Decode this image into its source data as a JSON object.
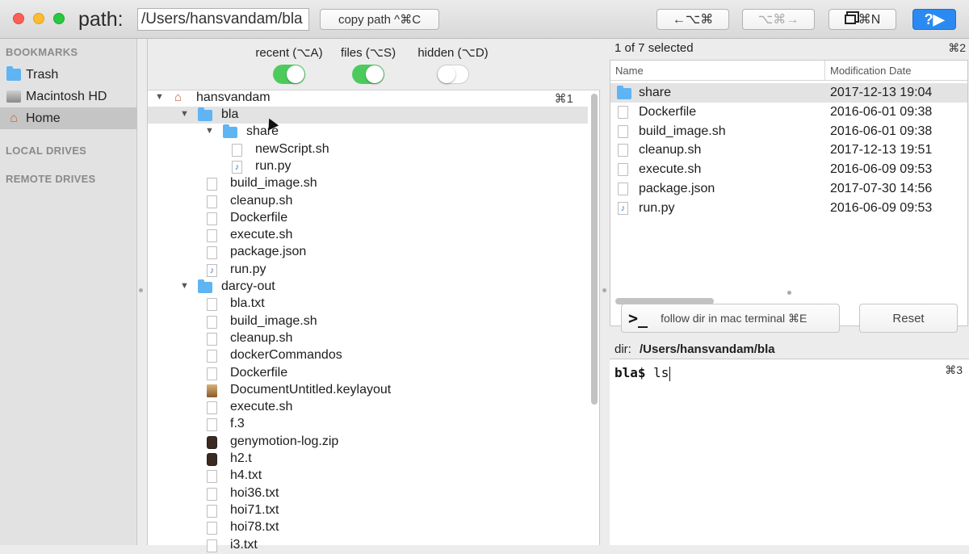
{
  "toolbar": {
    "path_label": "path:",
    "path_value": "/Users/hansvandam/bla",
    "copy_label": "copy path ^⌘C",
    "back_label": "←⌥⌘",
    "forward_label": "⌥⌘→",
    "new_window_label": "⌘N",
    "help_label": "?▶"
  },
  "sidebar": {
    "bookmarks_title": "BOOKMARKS",
    "items": [
      {
        "label": "Trash",
        "icon": "folder-icon"
      },
      {
        "label": "Macintosh HD",
        "icon": "disk-icon"
      },
      {
        "label": "Home",
        "icon": "home-icon",
        "selected": true
      }
    ],
    "local_drives_title": "LOCAL DRIVES",
    "remote_drives_title": "REMOTE DRIVES"
  },
  "toggles": [
    {
      "label": "recent (⌥A)",
      "on": true
    },
    {
      "label": "files  (⌥S)",
      "on": true
    },
    {
      "label": "hidden  (⌥D)",
      "on": false
    }
  ],
  "tree": {
    "root_label": "hansvandam",
    "root_shortcut": "⌘1",
    "rows": [
      {
        "label": "bla",
        "type": "folder",
        "level": 1,
        "disclosure": "▼",
        "selected": true
      },
      {
        "label": "share",
        "type": "folder",
        "level": 2,
        "disclosure": "▼"
      },
      {
        "label": "newScript.sh",
        "type": "doc",
        "level": 3
      },
      {
        "label": "run.py",
        "type": "py",
        "level": 3
      },
      {
        "label": "build_image.sh",
        "type": "doc",
        "level": 2
      },
      {
        "label": "cleanup.sh",
        "type": "doc",
        "level": 2
      },
      {
        "label": "Dockerfile",
        "type": "doc",
        "level": 2
      },
      {
        "label": "execute.sh",
        "type": "doc",
        "level": 2
      },
      {
        "label": "package.json",
        "type": "doc",
        "level": 2
      },
      {
        "label": "run.py",
        "type": "py",
        "level": 2
      },
      {
        "label": "darcy-out",
        "type": "folder",
        "level": 1,
        "disclosure": "▼"
      },
      {
        "label": "bla.txt",
        "type": "doc",
        "level": 2
      },
      {
        "label": "build_image.sh",
        "type": "doc",
        "level": 2
      },
      {
        "label": "cleanup.sh",
        "type": "doc",
        "level": 2
      },
      {
        "label": "dockerCommandos",
        "type": "doc",
        "level": 2
      },
      {
        "label": "Dockerfile",
        "type": "doc",
        "level": 2
      },
      {
        "label": "DocumentUntitled.keylayout",
        "type": "keyboard",
        "level": 2
      },
      {
        "label": "execute.sh",
        "type": "doc",
        "level": 2
      },
      {
        "label": "f.3",
        "type": "doc",
        "level": 2
      },
      {
        "label": "genymotion-log.zip",
        "type": "dark",
        "level": 2
      },
      {
        "label": "h2.t",
        "type": "dark",
        "level": 2
      },
      {
        "label": "h4.txt",
        "type": "doc",
        "level": 2
      },
      {
        "label": "hoi36.txt",
        "type": "doc",
        "level": 2
      },
      {
        "label": "hoi71.txt",
        "type": "doc",
        "level": 2
      },
      {
        "label": "hoi78.txt",
        "type": "doc",
        "level": 2
      },
      {
        "label": "i3.txt",
        "type": "doc",
        "level": 2
      }
    ]
  },
  "file_list": {
    "selection_text": "1 of 7 selected",
    "shortcut": "⌘2",
    "columns": {
      "name": "Name",
      "date": "Modification Date"
    },
    "rows": [
      {
        "name": "share",
        "date": "2017-12-13  19:04",
        "type": "folder",
        "selected": true
      },
      {
        "name": "Dockerfile",
        "date": "2016-06-01  09:38",
        "type": "doc"
      },
      {
        "name": "build_image.sh",
        "date": "2016-06-01  09:38",
        "type": "doc"
      },
      {
        "name": "cleanup.sh",
        "date": "2017-12-13  19:51",
        "type": "doc"
      },
      {
        "name": "execute.sh",
        "date": "2016-06-09  09:53",
        "type": "doc"
      },
      {
        "name": "package.json",
        "date": "2017-07-30  14:56",
        "type": "doc"
      },
      {
        "name": "run.py",
        "date": "2016-06-09  09:53",
        "type": "py"
      }
    ]
  },
  "terminal": {
    "follow_icon": ">_",
    "follow_label": "follow dir in mac terminal ⌘E",
    "reset_label": "Reset",
    "dir_label": "dir:",
    "dir_path": "/Users/hansvandam/bla",
    "prompt_host": "bla$",
    "command": " ls",
    "shortcut": "⌘3"
  },
  "colors": {
    "folder": "#5fb4f3",
    "toggle_on": "#4ccb5c",
    "help_button": "#2a8af2",
    "selection": "#e3e3e3"
  }
}
